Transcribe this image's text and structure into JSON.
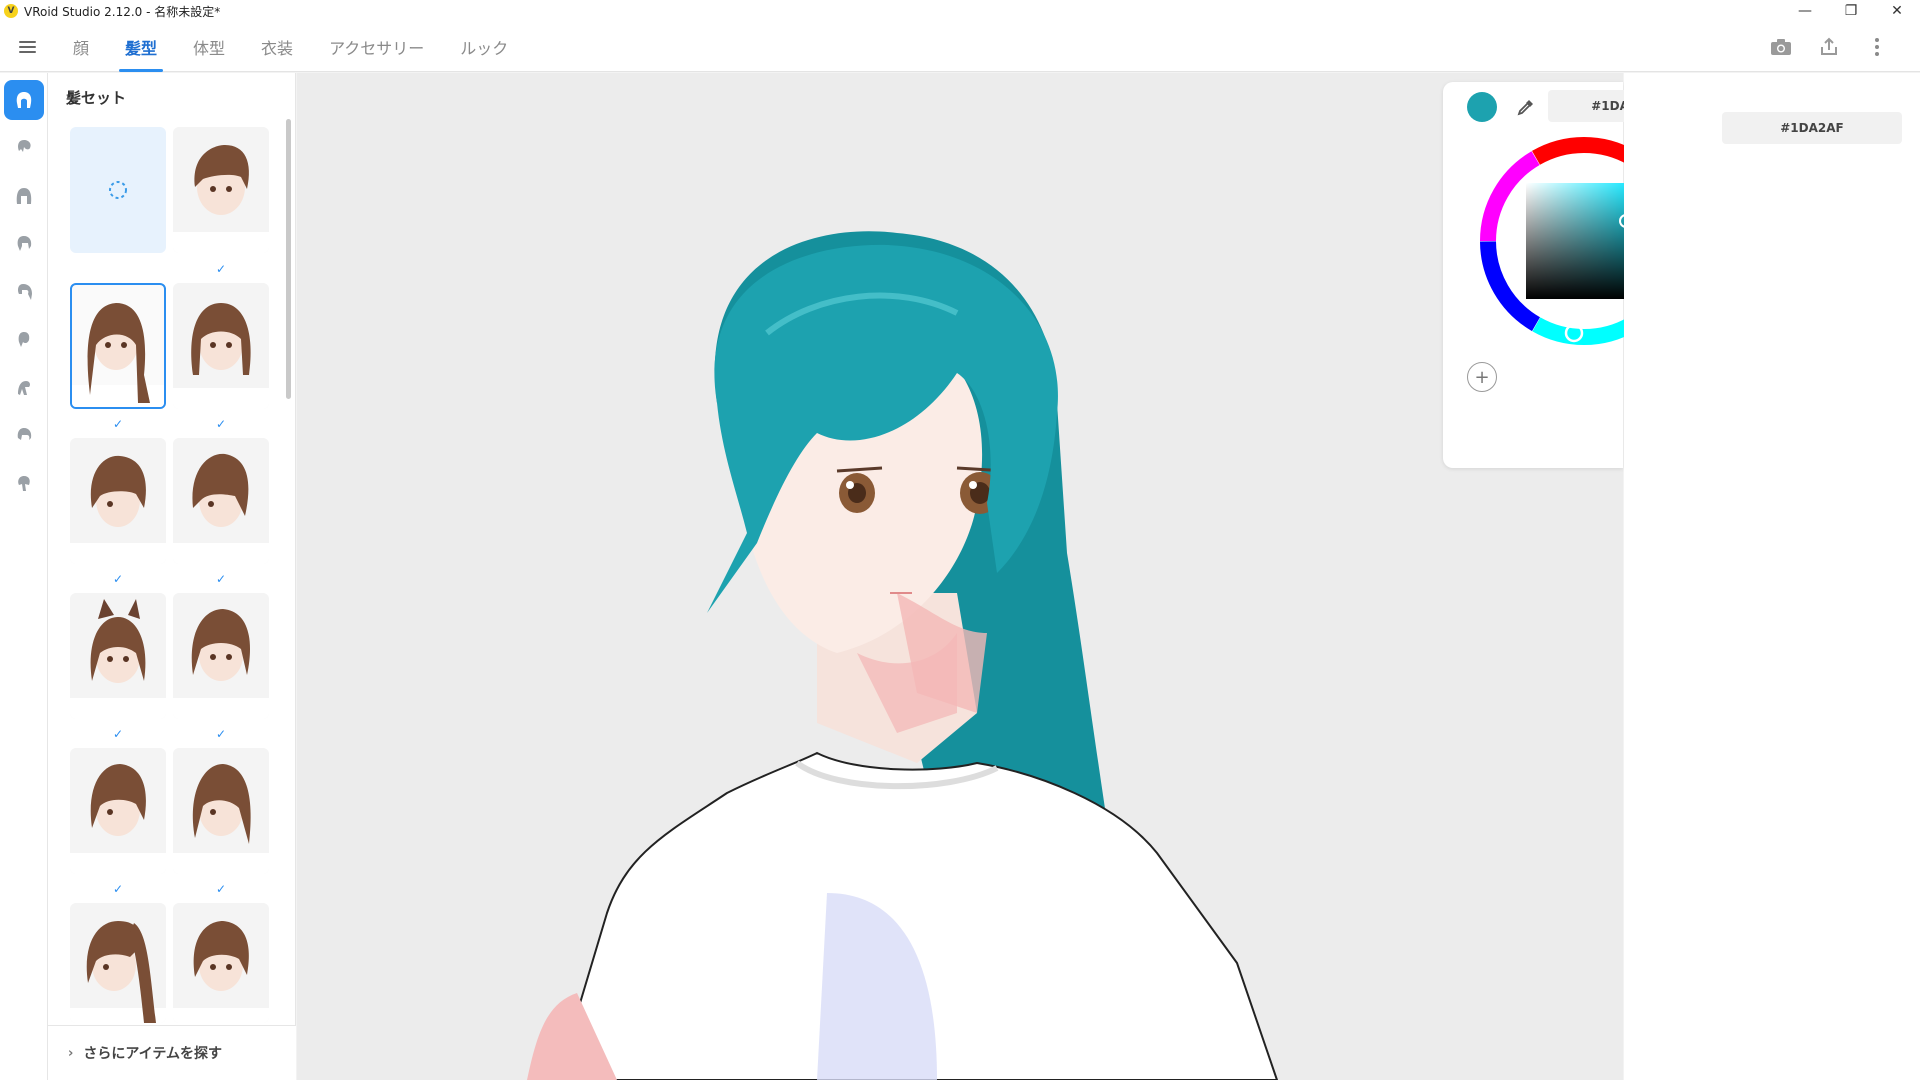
{
  "window": {
    "title": "VRoid Studio 2.12.0 - 名称未設定*",
    "logo_letter": "V",
    "minimize": "—",
    "maximize": "❐",
    "close": "✕"
  },
  "tabs": [
    {
      "label": "顔"
    },
    {
      "label": "髪型"
    },
    {
      "label": "体型"
    },
    {
      "label": "衣装"
    },
    {
      "label": "アクセサリー"
    },
    {
      "label": "ルック"
    }
  ],
  "active_tab": "髪型",
  "icons": {
    "menu": "hamburger-icon",
    "camera": "camera-icon",
    "export": "export-icon",
    "more": "more-vertical-icon"
  },
  "rail_items": [
    {
      "icon": "hair-set-icon",
      "active": true
    },
    {
      "icon": "front-hair-icon"
    },
    {
      "icon": "back-hair-icon"
    },
    {
      "icon": "side-hair-icon"
    },
    {
      "icon": "hair-tail-icon"
    },
    {
      "icon": "ahoge-icon"
    },
    {
      "icon": "extra-hair-icon"
    },
    {
      "icon": "hair-base-icon"
    },
    {
      "icon": "hair-color-icon"
    }
  ],
  "items_panel": {
    "title": "髪セット",
    "find_more": "さらにアイテムを探す",
    "check_mark": "✓"
  },
  "color": {
    "current_hex": "#1DA2AF",
    "picker_hex_value": "#1DA2AF",
    "panel_hex_value": "#1DA2AF",
    "add_label": "+"
  },
  "colors": {
    "accent": "#2b8ef0",
    "hair": "#1DA2AF",
    "brown_hair": "#8a5a3c"
  }
}
